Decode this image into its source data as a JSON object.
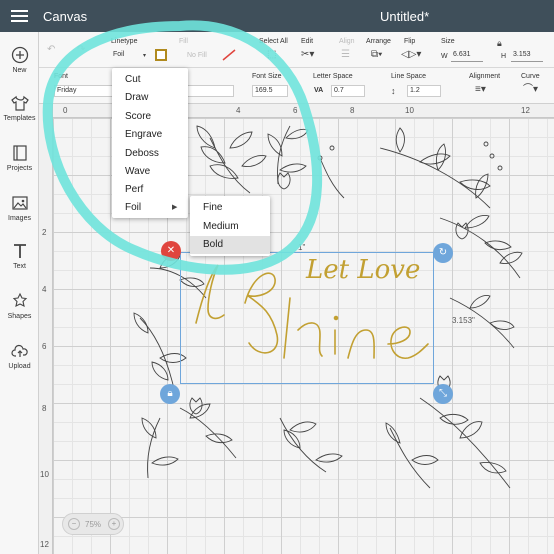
{
  "header": {
    "title": "Canvas",
    "doc_title": "Untitled*"
  },
  "sidebar": {
    "items": [
      {
        "label": "New",
        "icon": "plus-circle-icon"
      },
      {
        "label": "Templates",
        "icon": "shirt-icon"
      },
      {
        "label": "Projects",
        "icon": "book-icon"
      },
      {
        "label": "Images",
        "icon": "image-icon"
      },
      {
        "label": "Text",
        "icon": "text-T-icon"
      },
      {
        "label": "Shapes",
        "icon": "shapes-icon"
      },
      {
        "label": "Upload",
        "icon": "cloud-upload-icon"
      }
    ]
  },
  "toolbar": {
    "linetype_label": "Linetype",
    "linetype_value": "Foil",
    "fill_label": "Fill",
    "fill_value": "No Fill",
    "select_all_label": "Select All",
    "edit_label": "Edit",
    "align_label": "Align",
    "arrange_label": "Arrange",
    "flip_label": "Flip",
    "size_label": "Size",
    "width_label": "W",
    "width_value": "6.631",
    "height_label": "H",
    "height_value": "3.153"
  },
  "toolbar2": {
    "font_label": "Font",
    "font_value": "Friday",
    "font_size_label": "Font Size",
    "font_size_value": "169.5",
    "letter_space_label": "Letter Space",
    "letter_space_value": "0.7",
    "letter_space_icon_text": "VA",
    "line_space_label": "Line Space",
    "line_space_value": "1.2",
    "alignment_label": "Alignment",
    "curve_label": "Curve"
  },
  "ruler": {
    "top": [
      "0",
      "4",
      "6",
      "8",
      "10",
      "12"
    ],
    "left": [
      "2",
      "4",
      "6",
      "8",
      "10",
      "12"
    ]
  },
  "canvas": {
    "text_line1": "Let Love",
    "text_line2": "Shine",
    "text_color": "#c2a032",
    "width_dim": "3.153\"",
    "height_dim": "1\""
  },
  "linetype_menu": {
    "items": [
      "Cut",
      "Draw",
      "Score",
      "Engrave",
      "Deboss",
      "Wave",
      "Perf",
      "Foil"
    ],
    "submenu_arrow": "▶"
  },
  "foil_submenu": {
    "items": [
      "Fine",
      "Medium",
      "Bold"
    ],
    "selected": "Bold"
  },
  "zoom": {
    "value": "75%",
    "minus": "−",
    "plus": "+"
  },
  "colors": {
    "header_bg": "#3f4f5a",
    "highlight_teal": "#6fe3dc",
    "selection_blue": "#6fa6db",
    "delete_red": "#e0453e",
    "foil_gold": "#c2a032"
  }
}
